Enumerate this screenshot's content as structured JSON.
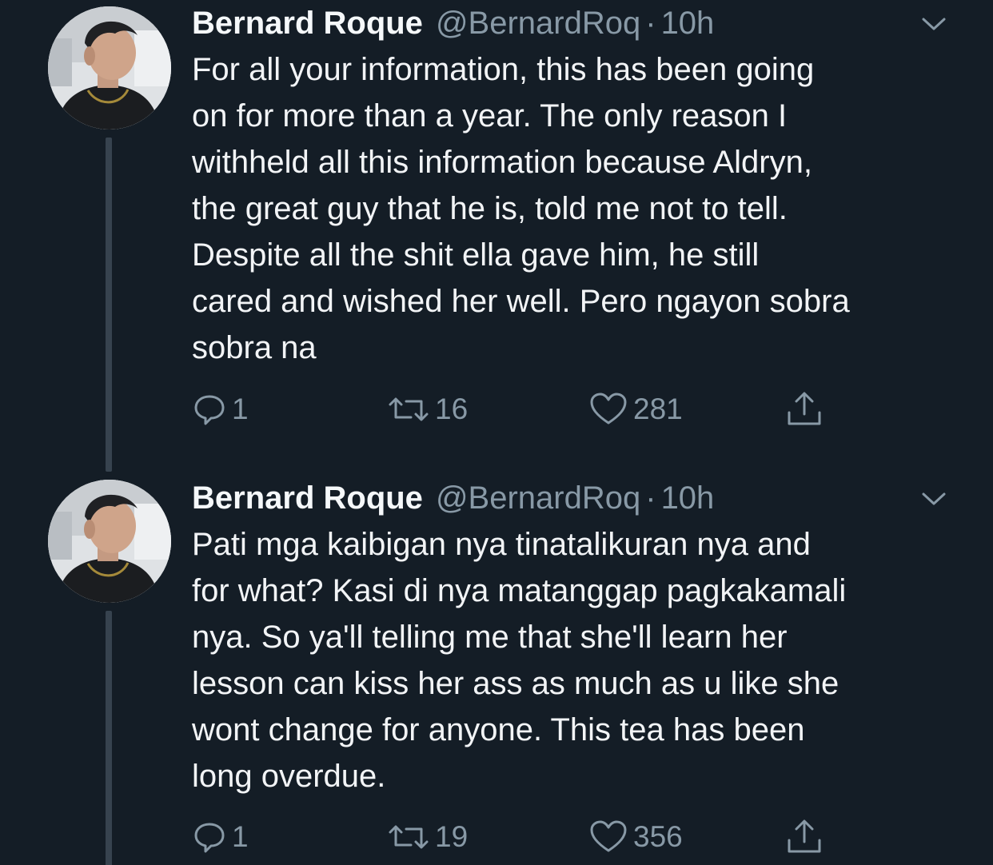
{
  "tweets": [
    {
      "author": {
        "name": "Bernard Roque",
        "handle": "@BernardRoq",
        "separator": "·",
        "time": "10h"
      },
      "lines": [
        "For all your information, this has been going",
        "on for more than a year. The only reason I",
        "withheld all this information because Aldryn,",
        "the great guy that he is, told me not to tell.",
        "Despite all the shit ella gave him, he still",
        "cared and wished her well. Pero ngayon sobra",
        "sobra na"
      ],
      "stats": {
        "replies": "1",
        "retweets": "16",
        "likes": "281"
      },
      "icons": [
        "reply-icon",
        "retweet-icon",
        "like-icon",
        "share-icon",
        "chevron-down-icon"
      ]
    },
    {
      "author": {
        "name": "Bernard Roque",
        "handle": "@BernardRoq",
        "separator": "·",
        "time": "10h"
      },
      "lines": [
        "Pati mga kaibigan nya tinatalikuran nya and",
        "for what? Kasi di nya matanggap pagkakamali",
        "nya. So ya'll telling me that she'll learn her",
        "lesson can kiss her ass as much as u like she",
        "wont change for anyone. This tea has been",
        "long overdue."
      ],
      "stats": {
        "replies": "1",
        "retweets": "19",
        "likes": "356"
      },
      "icons": [
        "reply-icon",
        "retweet-icon",
        "like-icon",
        "share-icon",
        "chevron-down-icon"
      ]
    }
  ],
  "colors": {
    "background": "#141d26",
    "secondary_text": "#8899a6",
    "thread_line": "#37434f"
  }
}
